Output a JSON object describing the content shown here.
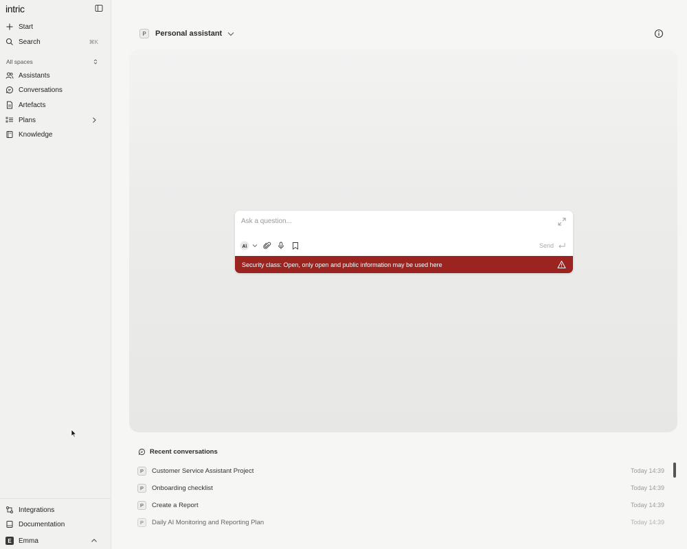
{
  "app": {
    "logo": "intric"
  },
  "sidebar": {
    "start_label": "Start",
    "search_label": "Search",
    "search_shortcut": "⌘K",
    "spaces_label": "All spaces",
    "items": [
      {
        "label": "Assistants",
        "icon": "users-icon"
      },
      {
        "label": "Conversations",
        "icon": "chat-bubble-icon"
      },
      {
        "label": "Artefacts",
        "icon": "document-icon"
      },
      {
        "label": "Plans",
        "icon": "list-icon"
      },
      {
        "label": "Knowledge",
        "icon": "book-icon"
      }
    ],
    "integrations_label": "Integrations",
    "documentation_label": "Documentation",
    "user": {
      "initial": "E",
      "name": "Emma"
    }
  },
  "main": {
    "assistant": {
      "badge": "P",
      "name": "Personal assistant"
    },
    "chat": {
      "placeholder": "Ask a question...",
      "send_label": "Send",
      "security_text": "Security class: Open, only open and public information may be used here"
    },
    "recent": {
      "title": "Recent conversations",
      "items": [
        {
          "badge": "P",
          "title": "Customer Service Assistant Project",
          "time": "Today 14:39"
        },
        {
          "badge": "P",
          "title": "Onboarding checklist",
          "time": "Today 14:39"
        },
        {
          "badge": "P",
          "title": "Create a Report",
          "time": "Today 14:39"
        },
        {
          "badge": "P",
          "title": "Daily AI Monitoring and Reporting Plan",
          "time": "Today 14:39"
        }
      ]
    }
  },
  "colors": {
    "security_bar": "#9b2320",
    "sidebar_bg": "#f1f1f0",
    "stage_bg": "#ececeb"
  }
}
